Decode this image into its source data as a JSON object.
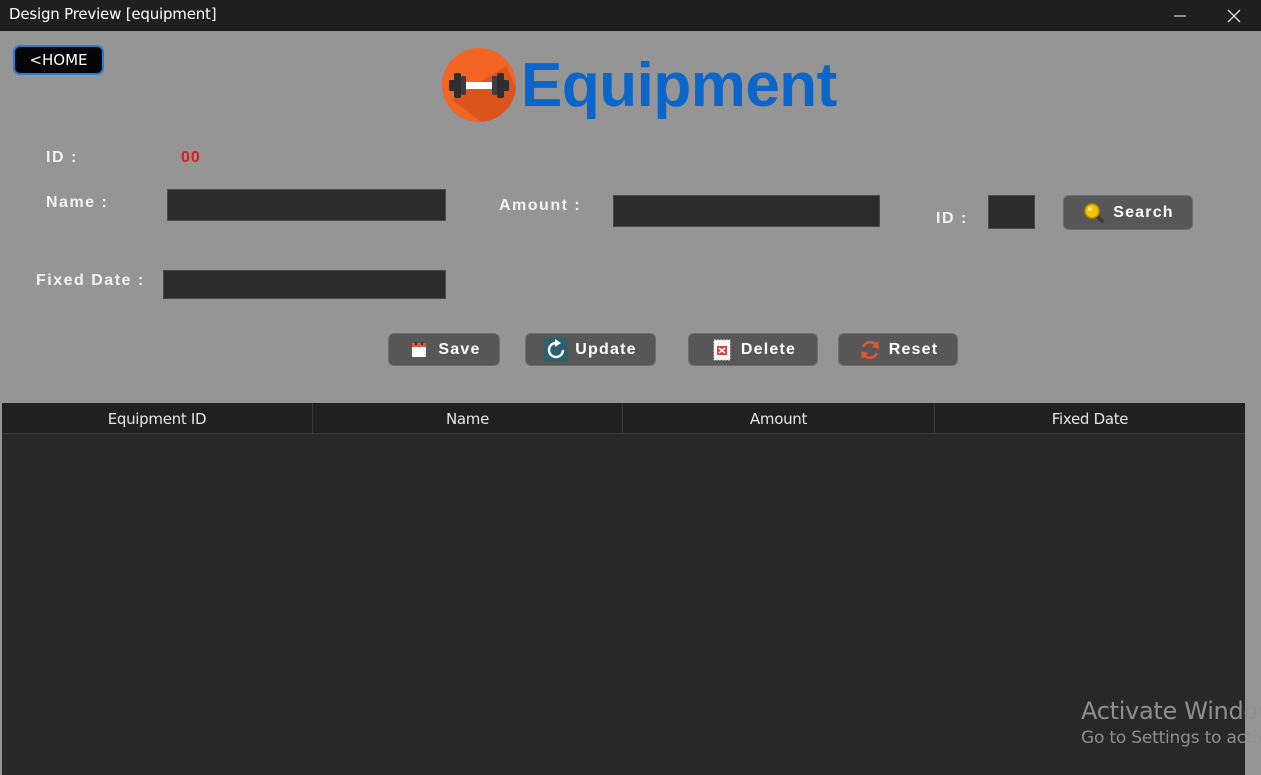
{
  "window": {
    "title": "Design Preview [equipment]",
    "minimize_glyph": "—",
    "close_glyph": "✕"
  },
  "nav": {
    "home_label": "<HOME"
  },
  "header": {
    "title": "Equipment",
    "logo_icon": "dumbbell-icon"
  },
  "form": {
    "id_label": "ID :",
    "id_value": "00",
    "name_label": "Name :",
    "name_value": "",
    "amount_label": "Amount :",
    "amount_value": "",
    "fixed_date_label": "Fixed Date :",
    "fixed_date_value": "",
    "search_id_label": "ID :",
    "search_id_value": "",
    "search_button": "Search"
  },
  "actions": {
    "save": "Save",
    "update": "Update",
    "delete": "Delete",
    "reset": "Reset"
  },
  "table": {
    "columns": [
      "Equipment ID",
      "Name",
      "Amount",
      "Fixed Date"
    ],
    "rows": []
  },
  "watermark": {
    "line1": "Activate Windows",
    "line2": "Go to Settings to activate Windows."
  },
  "colors": {
    "accent": "#0b66c9",
    "logo": "#f26522",
    "id_value": "#e21b1b",
    "background": "#959595",
    "table": "#282828"
  }
}
